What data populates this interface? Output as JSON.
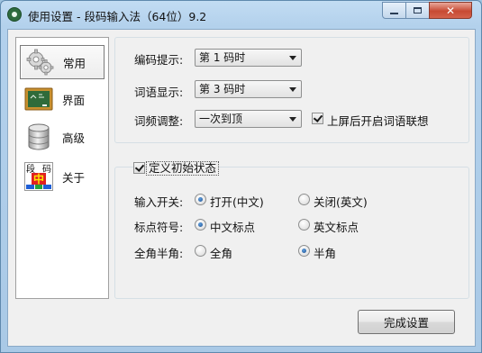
{
  "window": {
    "title": "使用设置 - 段码输入法（64位）9.2",
    "controls": {
      "minimize": "",
      "maximize": "",
      "close": "✕"
    }
  },
  "nav": {
    "items": [
      {
        "label": "常用",
        "icon": "gears-icon",
        "selected": true
      },
      {
        "label": "界面",
        "icon": "blackboard-icon",
        "selected": false
      },
      {
        "label": "高级",
        "icon": "database-icon",
        "selected": false
      },
      {
        "label": "关于",
        "icon": "duanma-logo-icon",
        "selected": false
      }
    ],
    "about_logo_chars": {
      "left": "段",
      "right": "码",
      "center": "中"
    }
  },
  "general": {
    "encode_hint": {
      "label": "编码提示:",
      "value": "第 1 码时"
    },
    "word_display": {
      "label": "词语显示:",
      "value": "第 3 码时"
    },
    "freq_adjust": {
      "label": "词频调整:",
      "value": "一次到顶"
    },
    "association": {
      "label": "上屏后开启词语联想",
      "checked": true
    }
  },
  "initial_state": {
    "caption": "定义初始状态",
    "enabled": true,
    "rows": [
      {
        "label": "输入开关:",
        "options": [
          "打开(中文)",
          "关闭(英文)"
        ],
        "selected": 0
      },
      {
        "label": "标点符号:",
        "options": [
          "中文标点",
          "英文标点"
        ],
        "selected": 0
      },
      {
        "label": "全角半角:",
        "options": [
          "全角",
          "半角"
        ],
        "selected": 1
      }
    ]
  },
  "buttons": {
    "finish": "完成设置"
  }
}
